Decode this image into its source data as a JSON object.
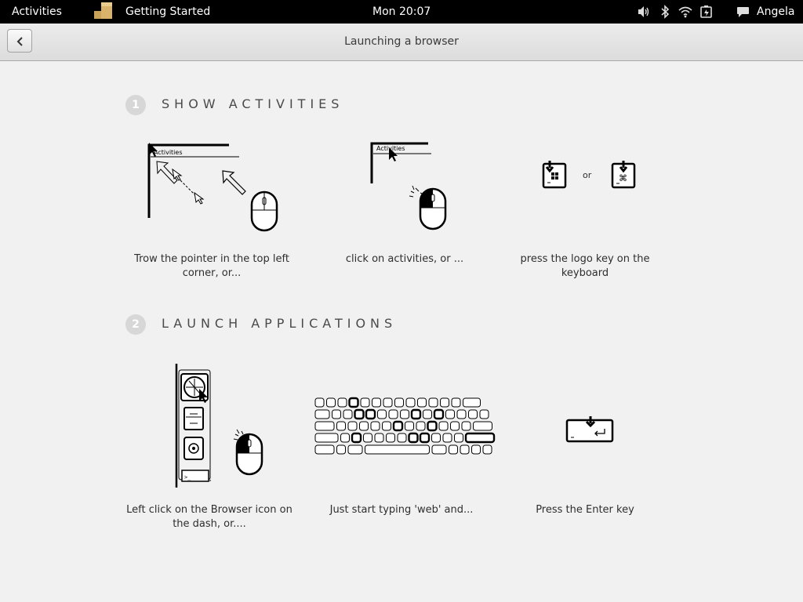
{
  "topbar": {
    "activities": "Activities",
    "app_name": "Getting Started",
    "clock": "Mon 20:07",
    "user": "Angela",
    "icons": [
      "app-icon",
      "volume-icon",
      "bluetooth-icon",
      "wifi-icon",
      "battery-icon",
      "chat-icon"
    ]
  },
  "header": {
    "title": "Launching a browser"
  },
  "sections": [
    {
      "number": "1",
      "title": "SHOW ACTIVITIES",
      "steps": [
        {
          "label": "Activities",
          "caption": "Trow the pointer in the top left corner, or..."
        },
        {
          "label": "Activities",
          "caption": "click on activities, or ..."
        },
        {
          "between_label": "or",
          "caption": "press the logo key on the keyboard"
        }
      ]
    },
    {
      "number": "2",
      "title": "LAUNCH APPLICATIONS",
      "steps": [
        {
          "caption": "Left click on the Browser icon on the dash, or...."
        },
        {
          "caption": "Just start typing 'web' and..."
        },
        {
          "caption": "Press the Enter key"
        }
      ]
    }
  ]
}
